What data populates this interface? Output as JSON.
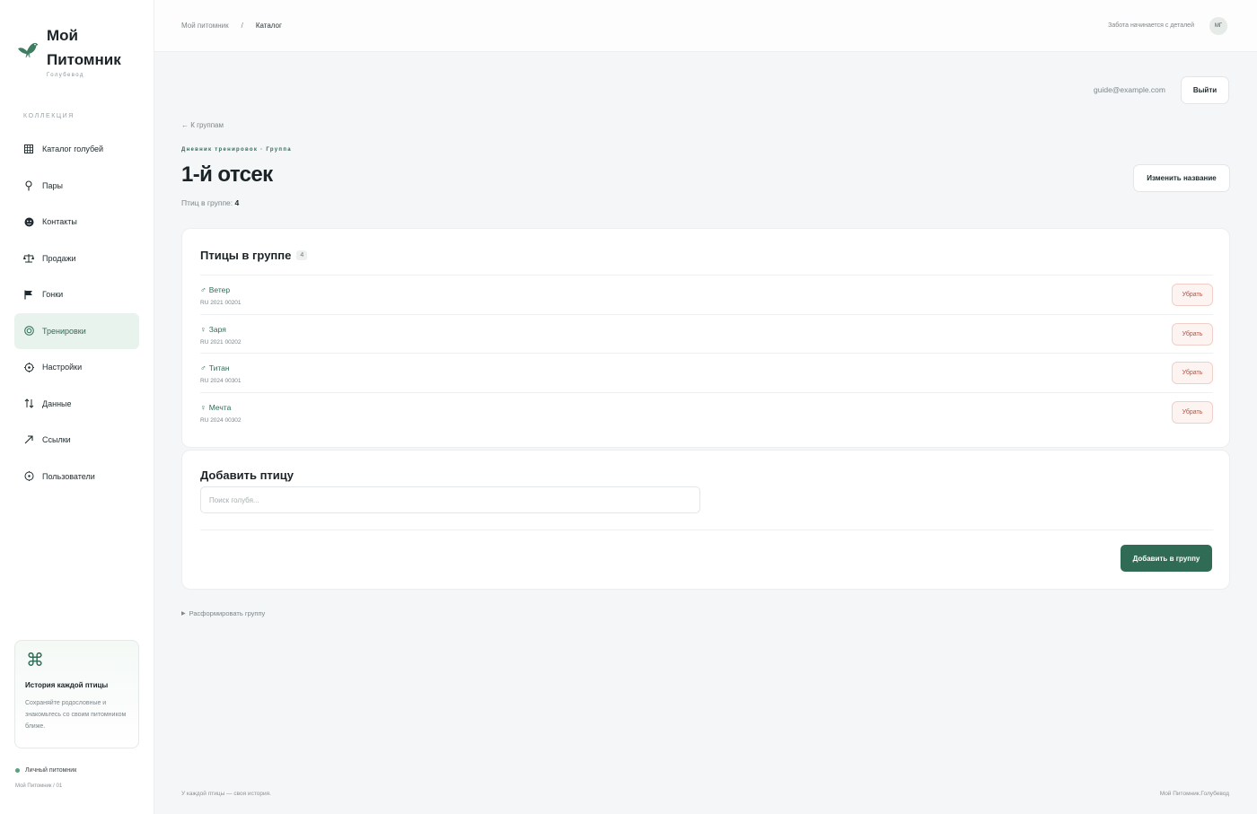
{
  "brand": {
    "title": "Мой Питомник",
    "subtitle": "Голубевод",
    "accent_color": "#2f6b55"
  },
  "sidebar": {
    "section_label": "КОЛЛЕКЦИЯ",
    "items": [
      {
        "label": "Каталог голубей",
        "icon": "grid-icon",
        "active": false
      },
      {
        "label": "Пары",
        "icon": "pin-icon",
        "active": false
      },
      {
        "label": "Контакты",
        "icon": "contacts-icon",
        "active": false
      },
      {
        "label": "Продажи",
        "icon": "scales-icon",
        "active": false
      },
      {
        "label": "Гонки",
        "icon": "flag-icon",
        "active": false
      },
      {
        "label": "Тренировки",
        "icon": "target-icon",
        "active": true
      },
      {
        "label": "Настройки",
        "icon": "gear-icon",
        "active": false
      },
      {
        "label": "Данные",
        "icon": "sort-icon",
        "active": false
      },
      {
        "label": "Ссылки",
        "icon": "arrow-up-right-icon",
        "active": false
      },
      {
        "label": "Пользователи",
        "icon": "users-icon",
        "active": false
      }
    ],
    "promo": {
      "icon": "command-icon",
      "title": "История каждой птицы",
      "text": "Сохраняйте родословные и знакомьтесь со своим питомником ближе."
    },
    "owner": {
      "label": "Личный питомник",
      "sub": "Мой Питомник / 01"
    }
  },
  "topbar": {
    "breadcrumb": [
      "Мой питомник",
      "/",
      "Каталог"
    ],
    "tagline": "Забота начинается с деталей",
    "avatar_initials": "МГ"
  },
  "account": {
    "email": "guide@example.com",
    "logout_label": "Выйти"
  },
  "page": {
    "back_label": "← К группам",
    "eyebrow": "Дневник тренировок · Группа",
    "title": "1-й отсек",
    "count_label": "Птиц в группе:",
    "count_value": "4",
    "rename_label": "Изменить название"
  },
  "birds_card": {
    "title": "Птицы в группе",
    "count": "4",
    "remove_label": "Убрать",
    "rows": [
      {
        "sex_icon": "male-icon",
        "sex_glyph": "♂",
        "name": "Ветер",
        "ring": "RU 2021 00201"
      },
      {
        "sex_icon": "female-icon",
        "sex_glyph": "♀",
        "name": "Заря",
        "ring": "RU 2021 00202"
      },
      {
        "sex_icon": "male-icon",
        "sex_glyph": "♂",
        "name": "Титан",
        "ring": "RU 2024 00301"
      },
      {
        "sex_icon": "female-icon",
        "sex_glyph": "♀",
        "name": "Мечта",
        "ring": "RU 2024 00302"
      }
    ]
  },
  "add_card": {
    "title": "Добавить птицу",
    "search_placeholder": "Поиск голубя...",
    "search_value": "",
    "submit_label": "Добавить в группу"
  },
  "disband_label": "Расформировать группу",
  "footer": {
    "left": "У каждой птицы — своя история.",
    "right": "Мой Питомник.Голубевод"
  }
}
